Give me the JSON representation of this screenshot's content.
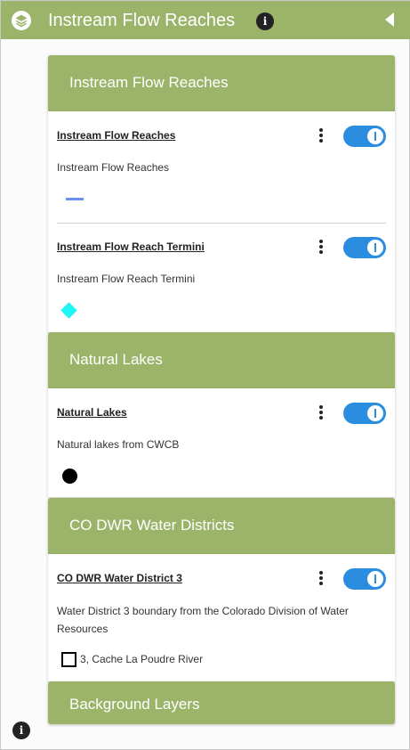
{
  "header": {
    "title": "Instream Flow Reaches",
    "info_icon": "info-icon",
    "layers_icon": "layers-icon",
    "collapse_icon": "triangle-left-icon"
  },
  "colors": {
    "header_green": "#9cb46a",
    "toggle_blue": "#2b8de0",
    "reach_line": "#6b8ff0",
    "termini_diamond": "#1ff5f5"
  },
  "sections": [
    {
      "title": "Instream Flow Reaches",
      "layers": [
        {
          "title": "Instream Flow Reaches",
          "description": "Instream Flow Reaches",
          "enabled": true,
          "legend": "blue-line"
        },
        {
          "title": "Instream Flow Reach Termini",
          "description": "Instream Flow Reach Termini",
          "enabled": true,
          "legend": "cyan-diamond"
        }
      ]
    },
    {
      "title": "Natural Lakes",
      "layers": [
        {
          "title": "Natural Lakes",
          "description": "Natural lakes from CWCB",
          "enabled": true,
          "legend": "black-dot"
        }
      ]
    },
    {
      "title": "CO DWR Water Districts",
      "layers": [
        {
          "title": "CO DWR Water District 3",
          "description": "Water District 3 boundary from the Colorado Division of Water Resources",
          "enabled": true,
          "legend": "square-outline",
          "legend_label": "3, Cache La Poudre River"
        }
      ]
    },
    {
      "title": "Background Layers",
      "layers": []
    }
  ]
}
